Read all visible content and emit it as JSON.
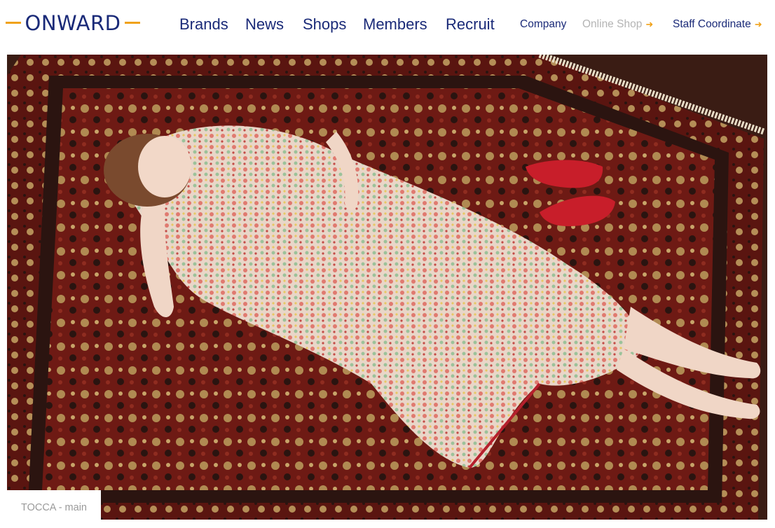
{
  "brand": {
    "logo_text": "ONWARD",
    "accent_color": "#f0a21a",
    "primary_color": "#1a2a78"
  },
  "main_nav": [
    "Brands",
    "News",
    "Shops",
    "Members",
    "Recruit"
  ],
  "sub_nav": {
    "company": "Company",
    "online_shop": "Online Shop",
    "staff_coordinate": "Staff Coordinate",
    "arrow_icon": "arrow-right-icon"
  },
  "hero": {
    "caption": "TOCCA - main"
  }
}
